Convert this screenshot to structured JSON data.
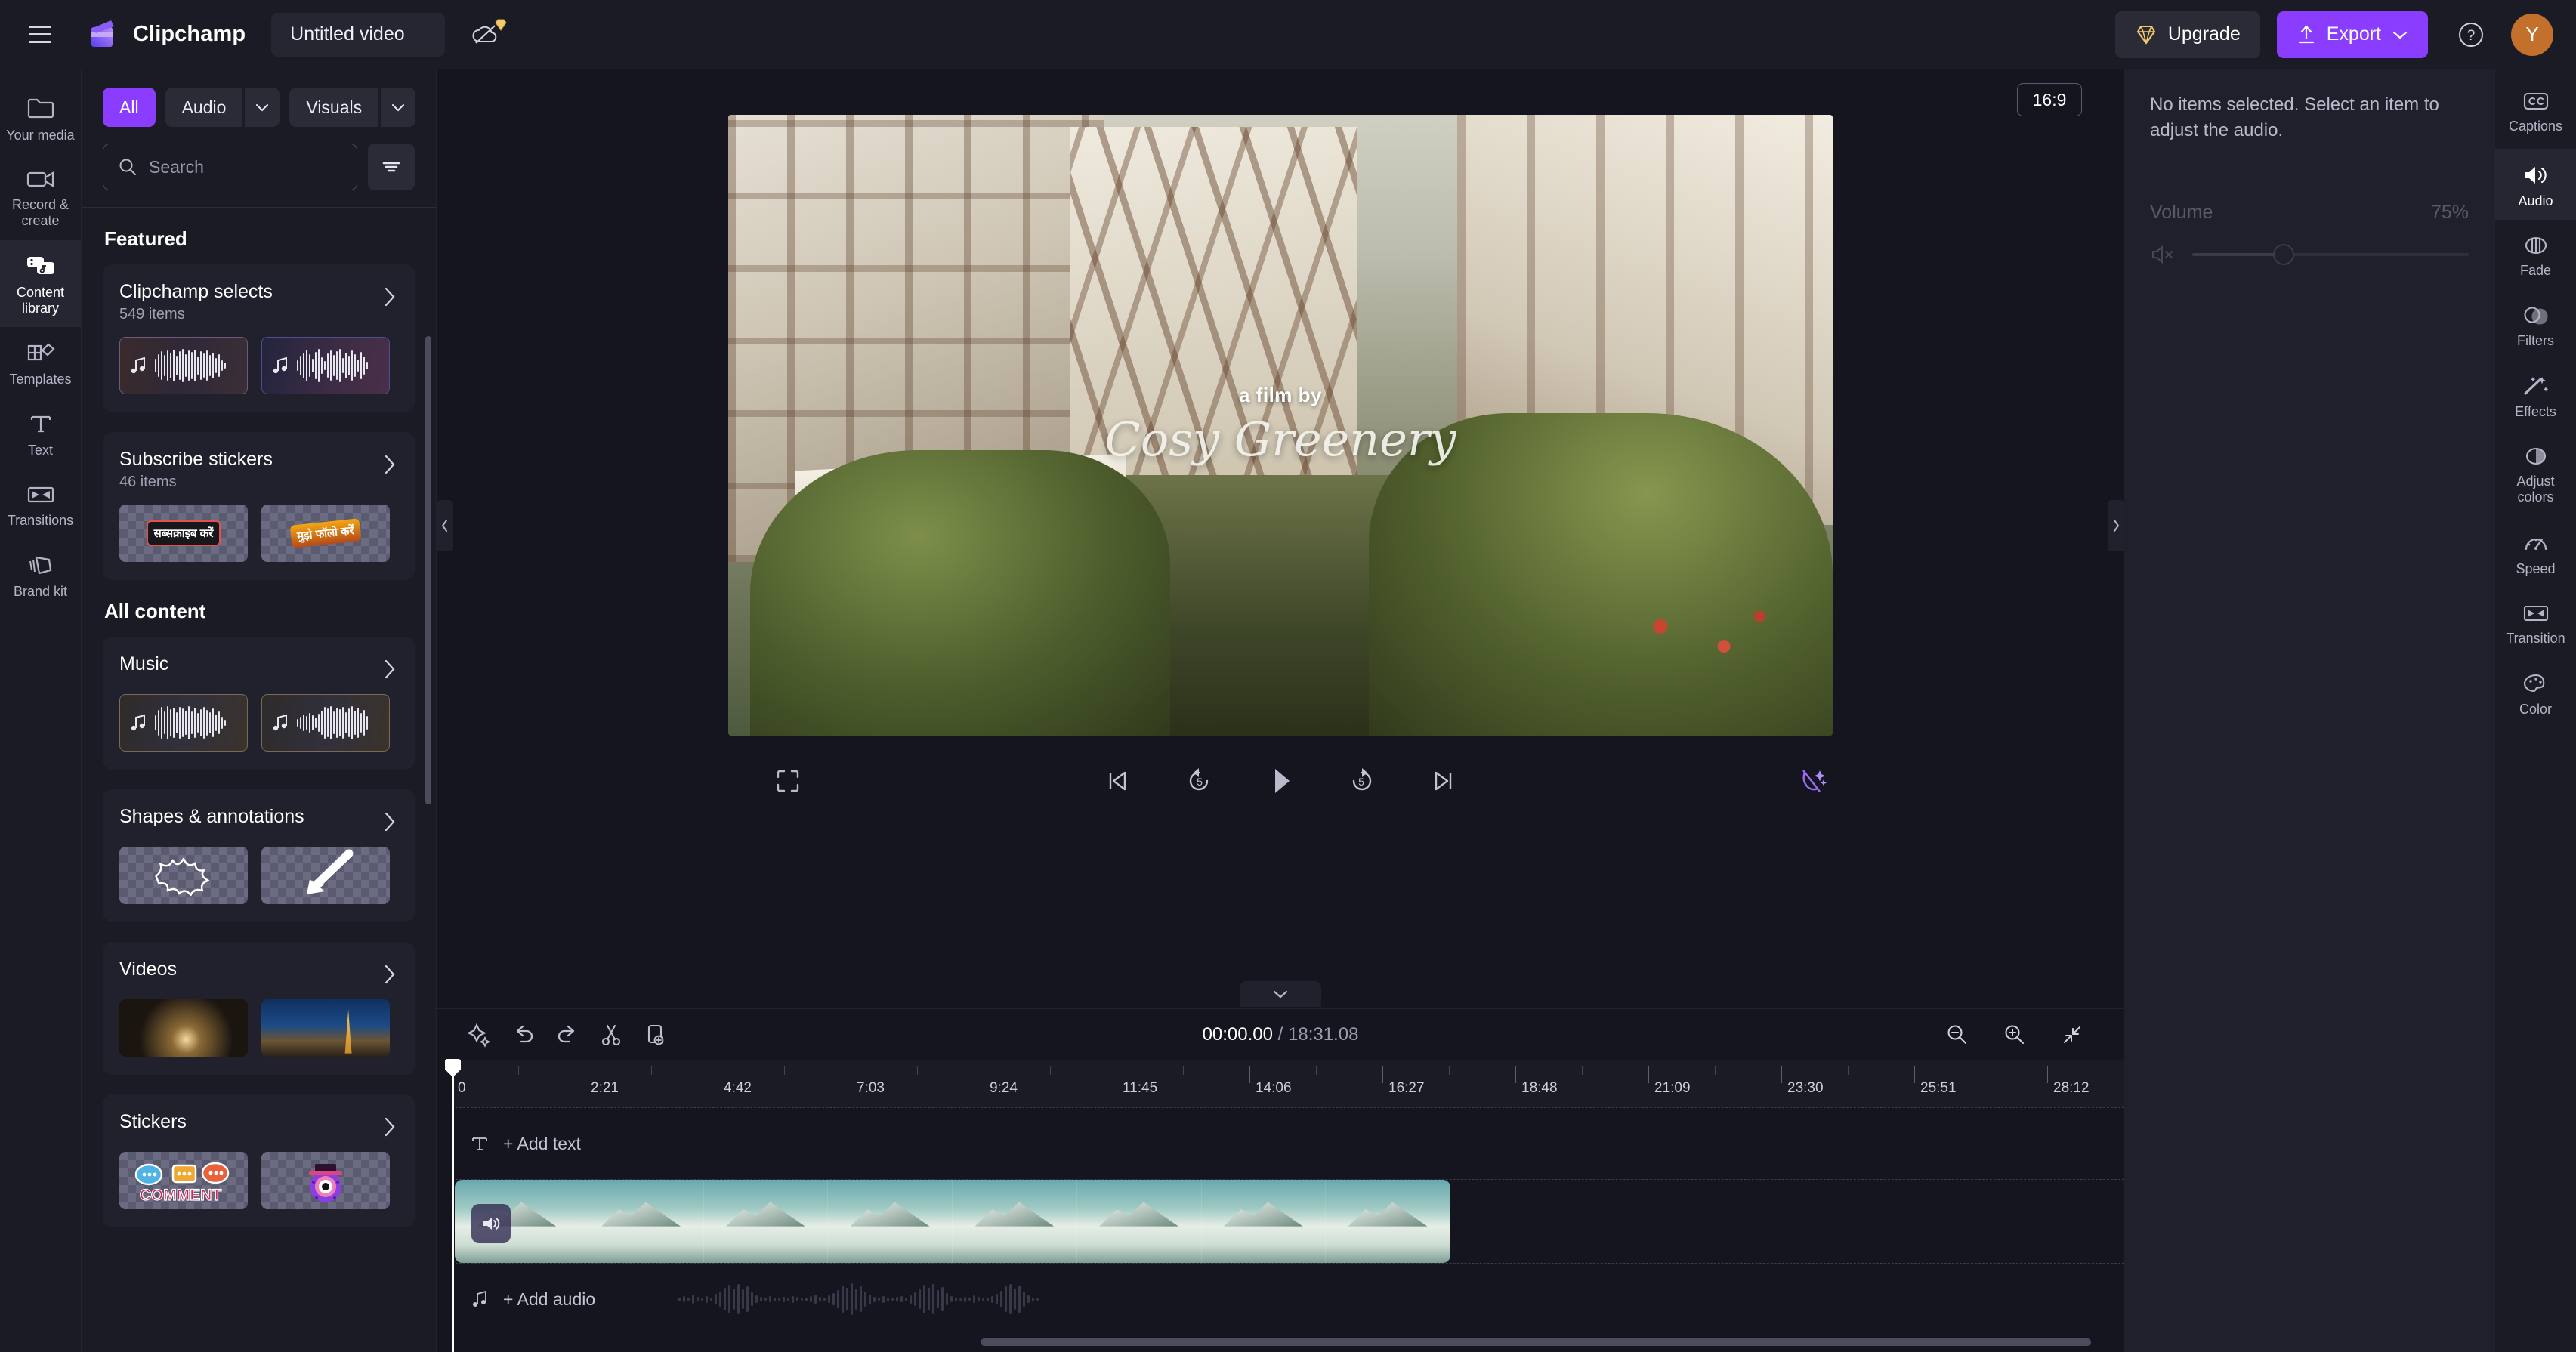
{
  "app": {
    "brand": "Clipchamp",
    "project_title": "Untitled video",
    "menu_icon": "hamburger-icon",
    "cloud_icon": "cloud-off-icon",
    "upgrade_label": "Upgrade",
    "export_label": "Export",
    "help_icon": "help-circle-icon",
    "avatar_initial": "Y",
    "accent": "#8b3dff",
    "avatar_color": "#c2702c"
  },
  "sidebar": {
    "items": [
      {
        "label": "Your media",
        "icon": "folder-icon",
        "active": false
      },
      {
        "label": "Record & create",
        "icon": "video-camera-icon",
        "active": false
      },
      {
        "label": "Content library",
        "icon": "content-library-icon",
        "active": true
      },
      {
        "label": "Templates",
        "icon": "templates-icon",
        "active": false
      },
      {
        "label": "Text",
        "icon": "text-icon",
        "active": false
      },
      {
        "label": "Transitions",
        "icon": "transitions-icon",
        "active": false
      },
      {
        "label": "Brand kit",
        "icon": "brand-kit-icon",
        "active": false
      }
    ]
  },
  "library": {
    "filters": [
      {
        "label": "All",
        "active": true,
        "caret": false
      },
      {
        "label": "Audio",
        "active": false,
        "caret": true
      },
      {
        "label": "Visuals",
        "active": false,
        "caret": true
      }
    ],
    "search_placeholder": "Search",
    "filter_icon": "filter-icon",
    "featured_title": "Featured",
    "all_content_title": "All content",
    "featured": [
      {
        "title": "Clipchamp selects",
        "subtitle": "549 items",
        "kind": "audio"
      },
      {
        "title": "Subscribe stickers",
        "subtitle": "46 items",
        "kind": "stickers",
        "thumbs": [
          "सब्सक्राइब करें",
          "मुझे फॉलो करें"
        ]
      }
    ],
    "all_content": [
      {
        "title": "Music",
        "kind": "audio"
      },
      {
        "title": "Shapes & annotations",
        "kind": "shapes"
      },
      {
        "title": "Videos",
        "kind": "videos"
      },
      {
        "title": "Stickers",
        "kind": "stickers2"
      }
    ]
  },
  "preview": {
    "aspect_ratio": "16:9",
    "overlay_line1": "a film by",
    "overlay_line2": "Cosy Greenery",
    "collapse_left_icon": "chevron-left-icon",
    "collapse_right_icon": "chevron-right-icon",
    "fullscreen_icon": "fullscreen-icon",
    "effects_icon": "ai-effects-icon",
    "controls": [
      {
        "name": "skip-to-start-button",
        "icon": "skip-start-icon"
      },
      {
        "name": "rewind-5-button",
        "icon": "rewind-5-icon",
        "label": "5"
      },
      {
        "name": "play-button",
        "icon": "play-icon"
      },
      {
        "name": "forward-5-button",
        "icon": "forward-5-icon",
        "label": "5"
      },
      {
        "name": "skip-to-end-button",
        "icon": "skip-end-icon"
      }
    ]
  },
  "timeline": {
    "tools": [
      {
        "name": "magic-tools-button",
        "icon": "sparkle-icon"
      },
      {
        "name": "undo-button",
        "icon": "undo-icon"
      },
      {
        "name": "redo-button",
        "icon": "redo-icon"
      },
      {
        "name": "split-button",
        "icon": "scissors-icon"
      },
      {
        "name": "duplicate-button",
        "icon": "duplicate-icon"
      }
    ],
    "current_time": "00:00.00",
    "separator": "/",
    "total_time": "18:31.08",
    "zoom_out_icon": "zoom-out-icon",
    "zoom_in_icon": "zoom-in-icon",
    "fit_icon": "fit-to-screen-icon",
    "collapse_icon": "chevron-down-icon",
    "ruler_labels": [
      "0",
      "2:21",
      "4:42",
      "7:03",
      "9:24",
      "11:45",
      "14:06",
      "16:27",
      "18:48",
      "21:09",
      "23:30",
      "25:51",
      "28:12"
    ],
    "add_text_label": "+ Add text",
    "add_text_icon": "text-icon",
    "add_audio_label": "+ Add audio",
    "add_audio_icon": "music-note-icon",
    "clip_audio_icon": "speaker-icon",
    "playhead_position": "0"
  },
  "properties": {
    "message": "No items selected. Select an item to adjust the audio.",
    "volume_label": "Volume",
    "volume_value": "75%",
    "mute_icon": "speaker-mute-icon"
  },
  "tool_rail": {
    "items": [
      {
        "label": "Captions",
        "icon": "cc-icon",
        "active": false,
        "sep_after": true
      },
      {
        "label": "Audio",
        "icon": "speaker-icon",
        "active": true
      },
      {
        "label": "Fade",
        "icon": "fade-icon",
        "active": false
      },
      {
        "label": "Filters",
        "icon": "filters-icon",
        "active": false
      },
      {
        "label": "Effects",
        "icon": "effects-wand-icon",
        "active": false
      },
      {
        "label": "Adjust colors",
        "icon": "adjust-colors-icon",
        "active": false
      },
      {
        "label": "Speed",
        "icon": "speedometer-icon",
        "active": false
      },
      {
        "label": "Transition",
        "icon": "transition-icon",
        "active": false
      },
      {
        "label": "Color",
        "icon": "palette-icon",
        "active": false
      }
    ]
  }
}
